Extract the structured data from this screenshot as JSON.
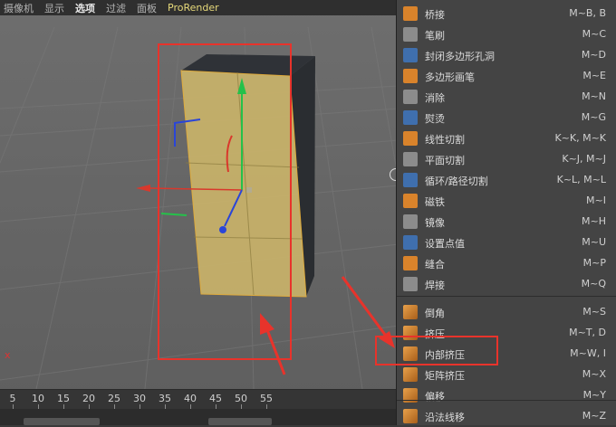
{
  "menubar": {
    "items": [
      "摄像机",
      "显示",
      "选项",
      "过滤",
      "面板",
      "ProRender"
    ],
    "active": "选项"
  },
  "timeline": {
    "ticks": [
      "5",
      "10",
      "15",
      "20",
      "25",
      "30",
      "35",
      "40",
      "45",
      "50",
      "55"
    ]
  },
  "viewport": {
    "axis_marker": "x"
  },
  "menu": {
    "items": [
      {
        "label": "桥接",
        "shortcut": "M~B, B",
        "icon": "bridge-icon"
      },
      {
        "label": "笔刷",
        "shortcut": "M~C",
        "icon": "brush-icon"
      },
      {
        "label": "封闭多边形孔洞",
        "shortcut": "M~D",
        "icon": "close-polygon-hole-icon"
      },
      {
        "label": "多边形画笔",
        "shortcut": "M~E",
        "icon": "polygon-pen-icon"
      },
      {
        "label": "消除",
        "shortcut": "M~N",
        "icon": "dissolve-icon"
      },
      {
        "label": "熨烫",
        "shortcut": "M~G",
        "icon": "iron-icon"
      },
      {
        "label": "线性切割",
        "shortcut": "K~K, M~K",
        "icon": "line-cut-icon"
      },
      {
        "label": "平面切割",
        "shortcut": "K~J, M~J",
        "icon": "plane-cut-icon"
      },
      {
        "label": "循环/路径切割",
        "shortcut": "K~L, M~L",
        "icon": "loop-path-cut-icon"
      },
      {
        "label": "磁铁",
        "shortcut": "M~I",
        "icon": "magnet-icon"
      },
      {
        "label": "镜像",
        "shortcut": "M~H",
        "icon": "mirror-icon"
      },
      {
        "label": "设置点值",
        "shortcut": "M~U",
        "icon": "set-point-value-icon"
      },
      {
        "label": "缝合",
        "shortcut": "M~P",
        "icon": "stitch-icon"
      },
      {
        "label": "焊接",
        "shortcut": "M~Q",
        "icon": "weld-icon"
      },
      {
        "label": "倒角",
        "shortcut": "M~S",
        "icon": "bevel-icon"
      },
      {
        "label": "挤压",
        "shortcut": "M~T, D",
        "icon": "extrude-icon"
      },
      {
        "label": "内部挤压",
        "shortcut": "M~W, I",
        "icon": "extrude-inner-icon"
      },
      {
        "label": "矩阵挤压",
        "shortcut": "M~X",
        "icon": "matrix-extrude-icon"
      },
      {
        "label": "偏移",
        "shortcut": "M~Y",
        "icon": "offset-icon"
      },
      {
        "label": "沿法线移",
        "shortcut": "M~Z",
        "icon": "normal-move-icon"
      }
    ]
  },
  "colors": {
    "highlight_red": "#e8332b",
    "selected_face": "#c9b36a",
    "menu_bg": "#444444",
    "icon_orange": "#d9832b"
  }
}
